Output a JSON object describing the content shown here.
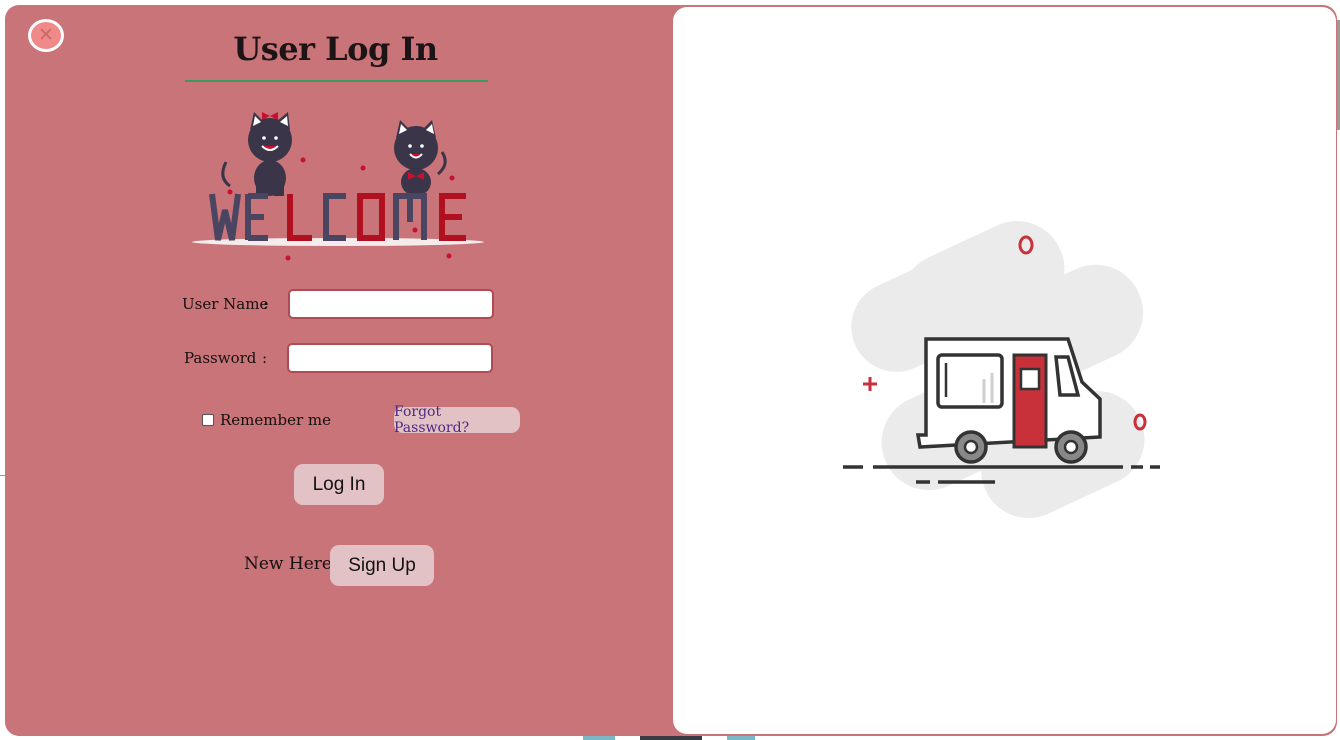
{
  "modal": {
    "title": "User Log In",
    "welcome_image": "welcome-cats-illustration",
    "form": {
      "username_label": "User Name",
      "password_label": "Password",
      "colon": ":",
      "username_value": "",
      "password_value": "",
      "remember_label": "Remember me",
      "remember_checked": false,
      "forgot_label": "Forgot Password?",
      "login_label": "Log In",
      "new_here_text": "New Here?",
      "signup_label": "Sign Up"
    },
    "close_icon": "close-icon",
    "side_image": "delivery-truck-illustration"
  },
  "colors": {
    "modal_bg": "#c87478",
    "button_bg": "#e3c2c6",
    "field_border": "#b04a55",
    "title_rule": "#3a9a5c",
    "accent_red": "#c8303a"
  }
}
